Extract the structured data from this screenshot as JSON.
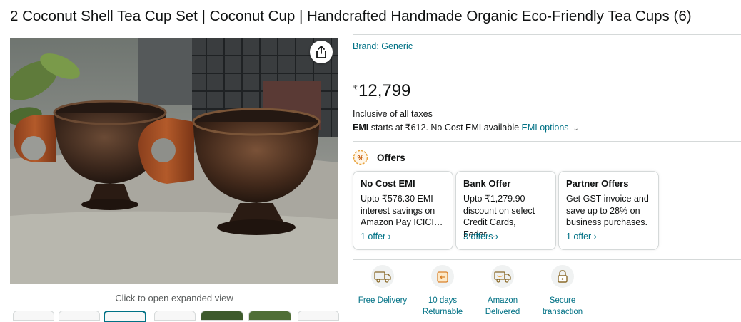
{
  "product": {
    "title": "2 Coconut Shell Tea Cup Set | Coconut Cup | Handcrafted Handmade Organic Eco-Friendly Tea Cups (6)"
  },
  "gallery": {
    "caption": "Click to open expanded view",
    "share_icon": "share-icon"
  },
  "brand": {
    "label": "Brand: Generic"
  },
  "price": {
    "symbol": "₹",
    "whole": "12,799"
  },
  "taxes_label": "Inclusive of all taxes",
  "emi": {
    "label": "EMI",
    "text": " starts at ₹612. No Cost EMI available ",
    "link": "EMI options",
    "chevron_icon": "chevron-down-icon"
  },
  "offers": {
    "heading": "Offers",
    "icon": "offer-tag-icon",
    "cards": [
      {
        "title": "No Cost EMI",
        "body": "Upto ₹576.30 EMI interest savings on Amazon Pay ICICI…",
        "link": "1 offer ›"
      },
      {
        "title": "Bank Offer",
        "body": "Upto ₹1,279.90 discount on select Credit Cards, Feder…",
        "link": "3 offers ›"
      },
      {
        "title": "Partner Offers",
        "body": "Get GST invoice and save up to 28% on business purchases.",
        "link": "1 offer ›"
      }
    ]
  },
  "features": [
    {
      "label": "Free Delivery",
      "icon": "delivery-truck-icon"
    },
    {
      "label": "10 days Returnable",
      "icon": "return-box-icon"
    },
    {
      "label": "Amazon Delivered",
      "icon": "amazon-truck-icon"
    },
    {
      "label": "Secure transaction",
      "icon": "lock-icon"
    }
  ],
  "colors": {
    "link": "#007185",
    "text": "#0f1111",
    "muted": "#565959",
    "border": "#d5d9d9"
  }
}
